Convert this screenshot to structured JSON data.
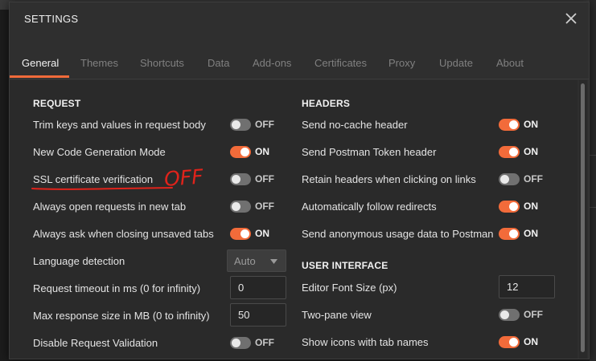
{
  "modal": {
    "title": "SETTINGS",
    "close_icon": "close-icon"
  },
  "tabs": [
    {
      "label": "General",
      "active": true
    },
    {
      "label": "Themes"
    },
    {
      "label": "Shortcuts"
    },
    {
      "label": "Data"
    },
    {
      "label": "Add-ons"
    },
    {
      "label": "Certificates"
    },
    {
      "label": "Proxy"
    },
    {
      "label": "Update"
    },
    {
      "label": "About"
    }
  ],
  "request": {
    "title": "REQUEST",
    "trim_keys": {
      "label": "Trim keys and values in request body",
      "state": "OFF"
    },
    "new_codegen": {
      "label": "New Code Generation Mode",
      "state": "ON"
    },
    "ssl_verification": {
      "label": "SSL certificate verification",
      "state": "OFF"
    },
    "open_new_tab": {
      "label": "Always open requests in new tab",
      "state": "OFF"
    },
    "ask_unsaved": {
      "label": "Always ask when closing unsaved tabs",
      "state": "ON"
    },
    "language_detection": {
      "label": "Language detection",
      "value": "Auto"
    },
    "request_timeout": {
      "label": "Request timeout in ms (0 for infinity)",
      "value": "0"
    },
    "max_response_size": {
      "label": "Max response size in MB (0 to infinity)",
      "value": "50"
    },
    "disable_validation": {
      "label": "Disable Request Validation",
      "state": "OFF"
    }
  },
  "headers": {
    "title": "HEADERS",
    "no_cache": {
      "label": "Send no-cache header",
      "state": "ON"
    },
    "postman_token": {
      "label": "Send Postman Token header",
      "state": "ON"
    },
    "retain_headers": {
      "label": "Retain headers when clicking on links",
      "state": "OFF"
    },
    "follow_redirects": {
      "label": "Automatically follow redirects",
      "state": "ON"
    },
    "usage_data": {
      "label": "Send anonymous usage data to Postman",
      "state": "ON"
    }
  },
  "ui": {
    "title": "USER INTERFACE",
    "font_size": {
      "label": "Editor Font Size (px)",
      "value": "12"
    },
    "two_pane": {
      "label": "Two-pane view",
      "state": "OFF"
    },
    "tab_icons": {
      "label": "Show icons with tab names",
      "state": "ON"
    }
  },
  "annotation": {
    "text": "OFF",
    "color": "#e0231b"
  },
  "colors": {
    "accent": "#f26b3a",
    "toggle_off": "#707070"
  }
}
